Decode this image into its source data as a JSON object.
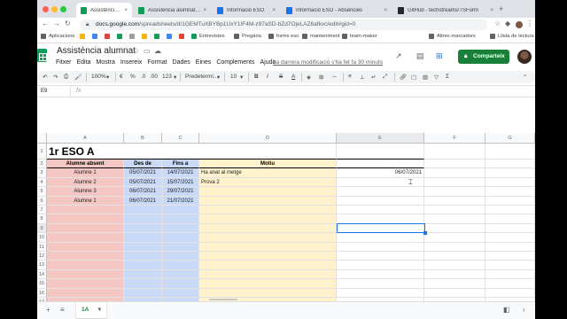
{
  "browser": {
    "tabs": [
      {
        "title": "Assistència alumnat - Fulls de càlc",
        "color": "#0f9d58",
        "active": true
      },
      {
        "title": "Assistència alumnat (respostes)",
        "color": "#0f9d58",
        "active": false
      },
      {
        "title": "Informació ESO",
        "color": "#1a73e8",
        "active": false
      },
      {
        "title": "Informació ESO - Absències",
        "color": "#1a73e8",
        "active": false
      },
      {
        "title": "GitHub - techstreams/TSForm",
        "color": "#24292e",
        "active": false
      }
    ],
    "url_host": "docs.google.com",
    "url_path": "/spreadsheets/d/1GEMTuXBYBp1UxY1IF4M-z97aSD-bZd7OjeLAZ6afkvc/edit#gid=0",
    "bookmarks": [
      {
        "label": "Aplicacions",
        "color": "#5f6368"
      },
      {
        "label": "",
        "color": "#f4b400"
      },
      {
        "label": "",
        "color": "#4285f4"
      },
      {
        "label": "",
        "color": "#db4437"
      },
      {
        "label": "",
        "color": "#0f9d58"
      },
      {
        "label": "",
        "color": "#9aa0a6"
      },
      {
        "label": "",
        "color": "#f4b400"
      },
      {
        "label": "",
        "color": "#0f9d58"
      },
      {
        "label": "",
        "color": "#4285f4"
      },
      {
        "label": "",
        "color": "#db4437"
      },
      {
        "label": "Entrevistes",
        "color": "#0f9d58"
      },
      {
        "label": "Pregària",
        "color": "#5f6368"
      },
      {
        "label": "forms eso",
        "color": "#5f6368"
      },
      {
        "label": "manteniment",
        "color": "#5f6368"
      },
      {
        "label": "team-maker",
        "color": "#5f6368"
      }
    ],
    "other_bookmarks": "Altres marcadors",
    "reading_list": "Llista de lectura"
  },
  "sheets": {
    "title": "Assistència alumnat",
    "menu": [
      "Fitxer",
      "Edita",
      "Mostra",
      "Insereix",
      "Format",
      "Dades",
      "Eines",
      "Complements",
      "Ajuda"
    ],
    "last_edit": "La darrera modificació s'ha fet fa 30 minuts",
    "share_label": "Comparteix",
    "toolbar": {
      "zoom": "100%",
      "currency": "€",
      "percent": "%",
      "decimals_less": ".0",
      "decimals_more": ".00",
      "more_formats": "123",
      "font": "Predetermi...",
      "font_size": "10",
      "bold": "B",
      "italic": "I",
      "strike": "S",
      "text_color": "A"
    },
    "name_box": "E9",
    "fx": "fx",
    "columns": [
      "A",
      "B",
      "C",
      "D",
      "E",
      "F",
      "G"
    ],
    "rows": [
      "1",
      "2",
      "3",
      "4",
      "5",
      "6",
      "7",
      "8",
      "9",
      "10",
      "11",
      "12",
      "13",
      "14",
      "15",
      "16",
      "17"
    ],
    "grid_title": "1r ESO A",
    "headers": [
      "Alumne absent",
      "Des de",
      "Fins a",
      "Motiu"
    ],
    "data_rows": [
      [
        "Alumne 1",
        "05/07/2021",
        "14/07/2021",
        "Ha anat al metge"
      ],
      [
        "Alumne 2",
        "05/07/2021",
        "15/07/2021",
        "Prova 2"
      ],
      [
        "Alumne 3",
        "06/07/2021",
        "29/07/2021",
        ""
      ],
      [
        "Alumne 1",
        "06/07/2021",
        "21/07/2021",
        ""
      ]
    ],
    "e3_value": "06/07/2021",
    "sheet_tab": "1A",
    "colors": {
      "red_col": "#f4c7c3",
      "blue_col": "#c9daf8",
      "yellow_col": "#fff2cc",
      "share_green": "#188038",
      "selection": "#1a73e8"
    }
  }
}
